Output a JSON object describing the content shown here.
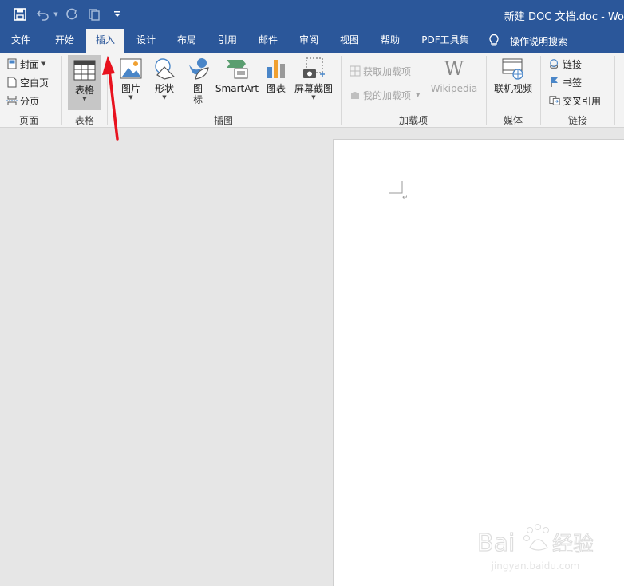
{
  "title_bar": {
    "title": "新建 DOC 文档.doc  -  Wo",
    "qat_icons": [
      "save-icon",
      "undo-icon",
      "redo-icon",
      "touch-mode-icon",
      "customize-qat-icon"
    ]
  },
  "tabs": [
    "文件",
    "开始",
    "插入",
    "设计",
    "布局",
    "引用",
    "邮件",
    "审阅",
    "视图",
    "帮助",
    "PDF工具集"
  ],
  "active_tab": "插入",
  "tell_me": "操作说明搜索",
  "ribbon": {
    "pages": {
      "cover": "封面",
      "blank": "空白页",
      "break": "分页",
      "label": "页面"
    },
    "tables": {
      "table": "表格",
      "label": "表格"
    },
    "illustrations": {
      "pictures": "图片",
      "shapes": "形状",
      "icons_1": "图",
      "icons_2": "标",
      "smartart": "SmartArt",
      "chart": "图表",
      "screenshot": "屏幕截图",
      "label": "插图"
    },
    "addins": {
      "get": "获取加载项",
      "my": "我的加载项",
      "wiki": "Wikipedia",
      "label": "加载项"
    },
    "media": {
      "video": "联机视频",
      "label": "媒体"
    },
    "links": {
      "link": "链接",
      "bookmark": "书签",
      "crossref": "交叉引用",
      "label": "链接"
    }
  },
  "watermark": {
    "logo_text": "Bai 经验",
    "domain": "jingyan.baidu.com"
  },
  "colors": {
    "title_bar": "#2b579a",
    "ribbon": "#f3f3f3",
    "canvas": "#e6e6e6",
    "annotation_arrow": "#e8121e"
  }
}
